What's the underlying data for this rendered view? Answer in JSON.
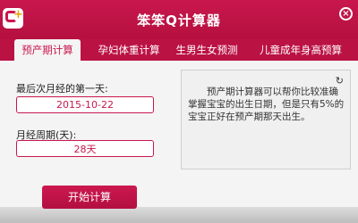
{
  "window": {
    "title": "笨笨Q计算器",
    "close_symbol": "×"
  },
  "logo": {
    "icon": "app-logo-icon"
  },
  "tabs": [
    {
      "label": "预产期计算",
      "active": true
    },
    {
      "label": "孕妇体重计算",
      "active": false
    },
    {
      "label": "生男生女预测",
      "active": false
    },
    {
      "label": "儿童成年身高预算",
      "active": false
    }
  ],
  "form": {
    "last_period_label": "最后次月经的第一天:",
    "last_period_value": "2015-10-22",
    "cycle_label": "月经周期(天):",
    "cycle_value": "28天"
  },
  "info": {
    "text": "预产期计算器可以帮你比较准确掌握宝宝的出生日期，但是只有5%的宝宝正好在预产期那天出生。",
    "refresh_symbol": "↻"
  },
  "actions": {
    "start_label": "开始计算"
  },
  "colors": {
    "brand": "#c8174d",
    "tab_bar": "#bb1244",
    "background": "#f4f4f4"
  }
}
